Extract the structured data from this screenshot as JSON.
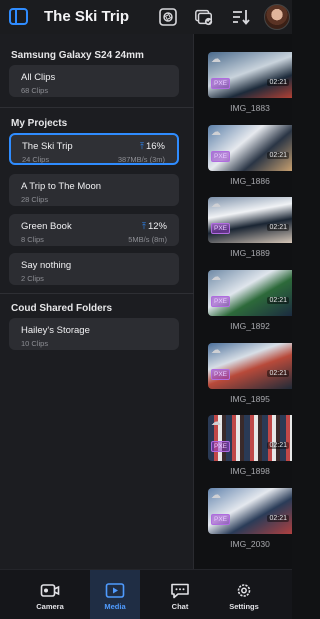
{
  "header": {
    "title": "The Ski Trip"
  },
  "device_section": {
    "title": "Samsung Galaxy S24 24mm",
    "all_clips": {
      "label": "All Clips",
      "count": "68 Clips"
    }
  },
  "projects_section": {
    "title": "My Projects",
    "items": [
      {
        "label": "The Ski Trip",
        "count": "24 Clips",
        "percent": "16%",
        "rate": "387MB/s (3m)"
      },
      {
        "label": "A Trip to The Moon",
        "count": "28 Clips"
      },
      {
        "label": "Green Book",
        "count": "8 Clips",
        "percent": "12%",
        "rate": "5MB/s (8m)"
      },
      {
        "label": "Say nothing",
        "count": "2 Clips"
      }
    ]
  },
  "cloud_section": {
    "title": "Coud Shared Folders",
    "items": [
      {
        "label": "Hailey's Storage",
        "count": "10 Clips"
      }
    ]
  },
  "clips": [
    {
      "name": "IMG_1883",
      "badge": "PXE",
      "duration": "02:21"
    },
    {
      "name": "IMG_1886",
      "badge": "PXE",
      "duration": "02:21"
    },
    {
      "name": "IMG_1889",
      "badge": "PXE",
      "duration": "02:21"
    },
    {
      "name": "IMG_1892",
      "badge": "PXE",
      "duration": "02:21"
    },
    {
      "name": "IMG_1895",
      "badge": "PXE",
      "duration": "02:21"
    },
    {
      "name": "IMG_1898",
      "badge": "PXE",
      "duration": "02:21"
    },
    {
      "name": "IMG_2030",
      "badge": "PXE",
      "duration": "02:21"
    }
  ],
  "bottom_nav": {
    "items": [
      {
        "label": "Camera",
        "icon": "camera-icon"
      },
      {
        "label": "Media",
        "icon": "media-icon",
        "active": true
      },
      {
        "label": "Chat",
        "icon": "chat-icon"
      },
      {
        "label": "Settings",
        "icon": "gear-icon"
      }
    ]
  },
  "colors": {
    "accent": "#2f8cff",
    "panel": "#1c1d21",
    "card": "#2c2d32",
    "badge": "#b06be0"
  }
}
